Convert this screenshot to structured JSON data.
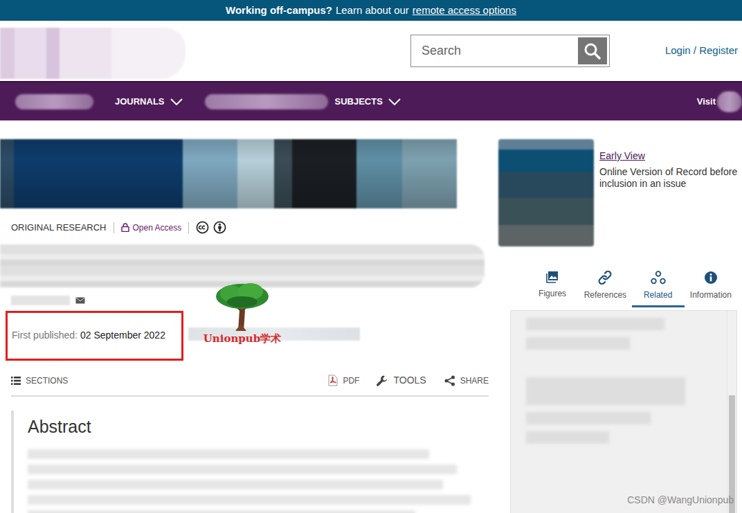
{
  "banner": {
    "lead": "Working off-campus?",
    "text": "Learn about our",
    "link": "remote access options"
  },
  "search": {
    "placeholder": "Search"
  },
  "login": "Login / Register",
  "nav": {
    "journals": "JOURNALS",
    "subjects": "SUBJECTS",
    "visit": "Visit"
  },
  "article": {
    "type": "ORIGINAL RESEARCH",
    "access": "Open Access",
    "published_label": "First published:",
    "published_date": "02 September 2022"
  },
  "toolbar": {
    "sections": "SECTIONS",
    "pdf": "PDF",
    "tools": "TOOLS",
    "share": "SHARE"
  },
  "abstract": {
    "heading": "Abstract"
  },
  "issue": {
    "link": "Early View",
    "desc": "Online Version of Record before inclusion in an issue"
  },
  "tabs": [
    {
      "label": "Figures",
      "selected": false
    },
    {
      "label": "References",
      "selected": false
    },
    {
      "label": "Related",
      "selected": true
    },
    {
      "label": "Information",
      "selected": false
    }
  ],
  "watermarks": {
    "logo": "Unionpub学术",
    "csdn": "CSDN @WangUnionpub"
  }
}
